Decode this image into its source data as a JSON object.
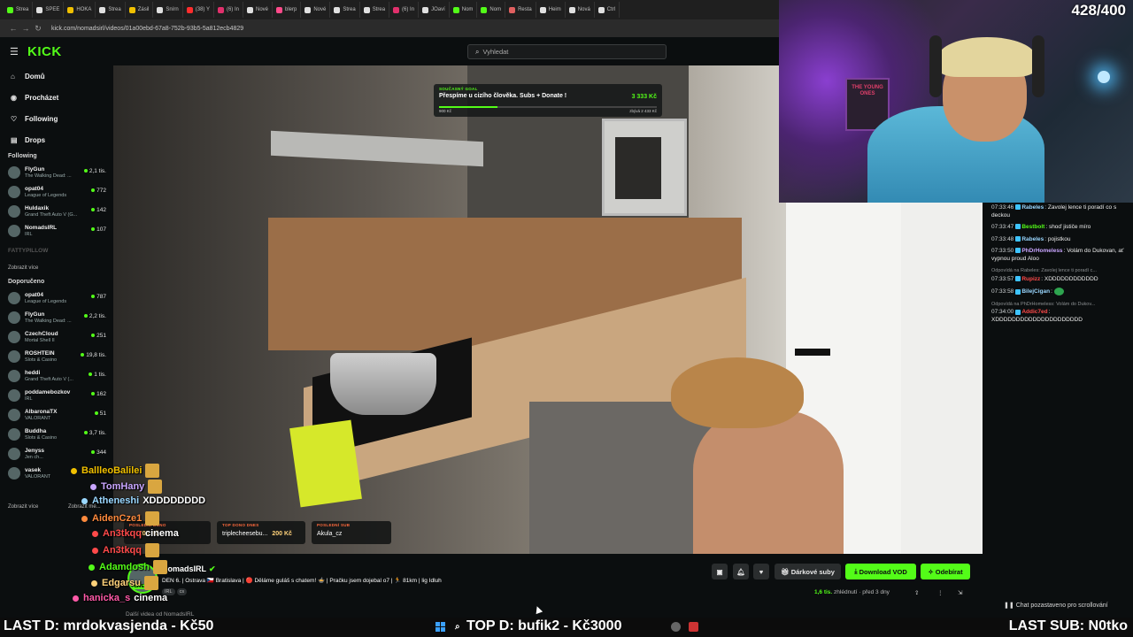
{
  "browser": {
    "tabs": [
      {
        "label": "Strea",
        "color": "#53fc18"
      },
      {
        "label": "SPEE",
        "color": "#e0e0e0"
      },
      {
        "label": "HOKA",
        "color": "#f0c000"
      },
      {
        "label": "Strea",
        "color": "#e0e0e0"
      },
      {
        "label": "Zásil",
        "color": "#f0c000"
      },
      {
        "label": "Snírn",
        "color": "#e0e0e0"
      },
      {
        "label": "(38) Y",
        "color": "#ff2d2d"
      },
      {
        "label": "(6) In",
        "color": "#e1306c"
      },
      {
        "label": "Nové",
        "color": "#e0e0e0"
      },
      {
        "label": "blerp",
        "color": "#ff4a8a"
      },
      {
        "label": "Nové",
        "color": "#e0e0e0"
      },
      {
        "label": "Strea",
        "color": "#e0e0e0"
      },
      {
        "label": "Strea",
        "color": "#e0e0e0"
      },
      {
        "label": "(6) In",
        "color": "#e1306c"
      },
      {
        "label": "JOaví",
        "color": "#e0e0e0"
      },
      {
        "label": "Nom",
        "color": "#53fc18"
      },
      {
        "label": "Nom",
        "color": "#53fc18"
      },
      {
        "label": "Resta",
        "color": "#e06060"
      },
      {
        "label": "Heim",
        "color": "#e0e0e0"
      },
      {
        "label": "Nová",
        "color": "#e0e0e0"
      },
      {
        "label": "Ctrl",
        "color": "#e0e0e0"
      }
    ],
    "url": "kick.com/nomadsirl/videos/01a00ebd-67a8-752b-93b5-5a812ecb4829"
  },
  "kick": {
    "logo": "KICK",
    "search_placeholder": "Vyhledat",
    "nav": [
      {
        "label": "Domů",
        "icon": "home-icon",
        "glyph": "⌂"
      },
      {
        "label": "Procházet",
        "icon": "browse-icon",
        "glyph": "◉"
      },
      {
        "label": "Following",
        "icon": "heart-icon",
        "glyph": "♡"
      },
      {
        "label": "Drops",
        "icon": "drops-icon",
        "glyph": "▤"
      }
    ],
    "following_title": "Following",
    "following": [
      {
        "name": "FlyGun",
        "game": "The Walking Dead: ...",
        "viewers": "2,1 tis."
      },
      {
        "name": "opat04",
        "game": "League of Legends",
        "viewers": "772"
      },
      {
        "name": "Huldaxik",
        "game": "Grand Theft Auto V (G...",
        "viewers": "142"
      },
      {
        "name": "NomadsIRL",
        "game": "IRL",
        "viewers": "107"
      }
    ],
    "offline_channel": "FATTYPILLOW",
    "show_more": "Zobrazit více",
    "recommended_title": "Doporučeno",
    "recommended": [
      {
        "name": "opat04",
        "game": "League of Legends",
        "viewers": "787"
      },
      {
        "name": "FlyGun",
        "game": "The Walking Dead: ...",
        "viewers": "2,2 tis."
      },
      {
        "name": "CzechCloud",
        "game": "Mortal Shell II",
        "viewers": "251"
      },
      {
        "name": "ROSHTEIN",
        "game": "Slots & Casino",
        "viewers": "19,8 tis."
      },
      {
        "name": "heddi",
        "game": "Grand Theft Auto V (...",
        "viewers": "1 tis."
      },
      {
        "name": "poddamebozkov",
        "game": "IRL",
        "viewers": "162"
      },
      {
        "name": "AlbaronaTX",
        "game": "VALORANT",
        "viewers": "51"
      },
      {
        "name": "Buddha",
        "game": "Slots & Casino",
        "viewers": "3,7 tis."
      },
      {
        "name": "Jenyss",
        "game": "Jen ch...",
        "viewers": "344"
      },
      {
        "name": "vasek",
        "game": "VALORANT",
        "viewers": ""
      }
    ],
    "show_more2": "Zobrazit více",
    "show_less": "Zobrazit mé..."
  },
  "goal": {
    "label": "SOUČASNÝ GOAL",
    "text": "Přespíme u cizího člověka. Subs + Donate !",
    "amount": "3 333 Kč",
    "progress": 0.27,
    "current": "900 Kč",
    "remaining": "zbývá 2 433 Kč"
  },
  "webcam": {
    "counter": "428/400",
    "poster_text": "THE YOUNG ONES"
  },
  "overlay_chat": [
    {
      "user": "BallleoBalilei",
      "color": "#f0c000",
      "msg": ""
    },
    {
      "user": "TomHany",
      "color": "#c9a6ff",
      "msg": ""
    },
    {
      "user": "Atheneshi",
      "color": "#9ad7ff",
      "msg": "XDDDDDDDD"
    },
    {
      "user": "AidenCze1",
      "color": "#ff8a3d",
      "msg": ""
    },
    {
      "user": "An3tkqq",
      "color": "#ff4a4a",
      "msg": "cinema"
    },
    {
      "user": "An3tkqq",
      "color": "#ff4a4a",
      "msg": ""
    },
    {
      "user": "Adamdosh",
      "color": "#53fc18",
      "msg": ""
    },
    {
      "user": "Edgarsu",
      "color": "#ffd27a",
      "msg": ""
    },
    {
      "user": "hanicka_s",
      "color": "#ff5aa8",
      "msg": "cinema"
    }
  ],
  "donations": [
    {
      "header": "POSLEDNÍ DONO",
      "name": "...",
      "amount": "200 Kč"
    },
    {
      "header": "TOP DONO DNES",
      "name": "triplecheesebu...",
      "amount": "200 Kč"
    },
    {
      "header": "POSLEDNÍ SUB",
      "name": "Akula_cz",
      "amount": ""
    }
  ],
  "channel": {
    "name": "NomadsIRL",
    "live": "LIVE",
    "title": "DEN 6. | Ostrava 🇨🇿 Bratislava | 🔴 Děláme guláš s chatem! 🍲 | Pračku jsem dojebal o7 | 🏃 81km | lig Idluh",
    "tags": [
      "IRL",
      "cs"
    ],
    "buttons": {
      "gift": "Dárkové suby",
      "download": "Download VOD",
      "subscribe": "Odebírat"
    },
    "views": "1,6 tis.",
    "views_label": "zhlédnutí",
    "ago": "před 3 dny",
    "more_videos": "Další videa od NomadsIRL"
  },
  "chat": {
    "messages": [
      {
        "time": "07:33:46",
        "user": "Rabeles",
        "color": "#9ad7ff",
        "text": "Zavolej lence ti poradí co s deckou",
        "reply": ""
      },
      {
        "time": "07:33:47",
        "user": "Bestbolt",
        "color": "#53fc18",
        "text": "shoď jističe míro",
        "reply": ""
      },
      {
        "time": "07:33:48",
        "user": "Rabeles",
        "color": "#9ad7ff",
        "text": "pojistkou",
        "reply": ""
      },
      {
        "time": "07:33:50",
        "user": "PhDrHomeless",
        "color": "#c9a6ff",
        "text": "Volám do Dukovan, ať vypnou proud Aloo",
        "reply": ""
      },
      {
        "time": "07:33:57",
        "user": "Rupizz",
        "color": "#ff4a4a",
        "text": "XDDDDDDDDDDDD",
        "reply": "Odpovídá na Rabeles: Zavolej lence ti poradí c..."
      },
      {
        "time": "07:33:58",
        "user": "BilejCigan",
        "color": "#9ad7ff",
        "text": "",
        "reply": ""
      },
      {
        "time": "07:34:00",
        "user": "Addic7ed",
        "color": "#ff4a4a",
        "text": "XDDDDDDDDDDDDDDDDDDDDD",
        "reply": "Odpovídá na PhDrHomeless: Volám do Dukov..."
      }
    ],
    "paused": "Chat pozastaveno pro scrollování"
  },
  "taskbar": {
    "left": "LAST D: mrdokvasjenda - Kč50",
    "center": "TOP D: bufik2 - Kč3000",
    "right": "LAST SUB: N0tko"
  },
  "colors": {
    "accent": "#53fc18",
    "bg": "#0b0e0f"
  }
}
